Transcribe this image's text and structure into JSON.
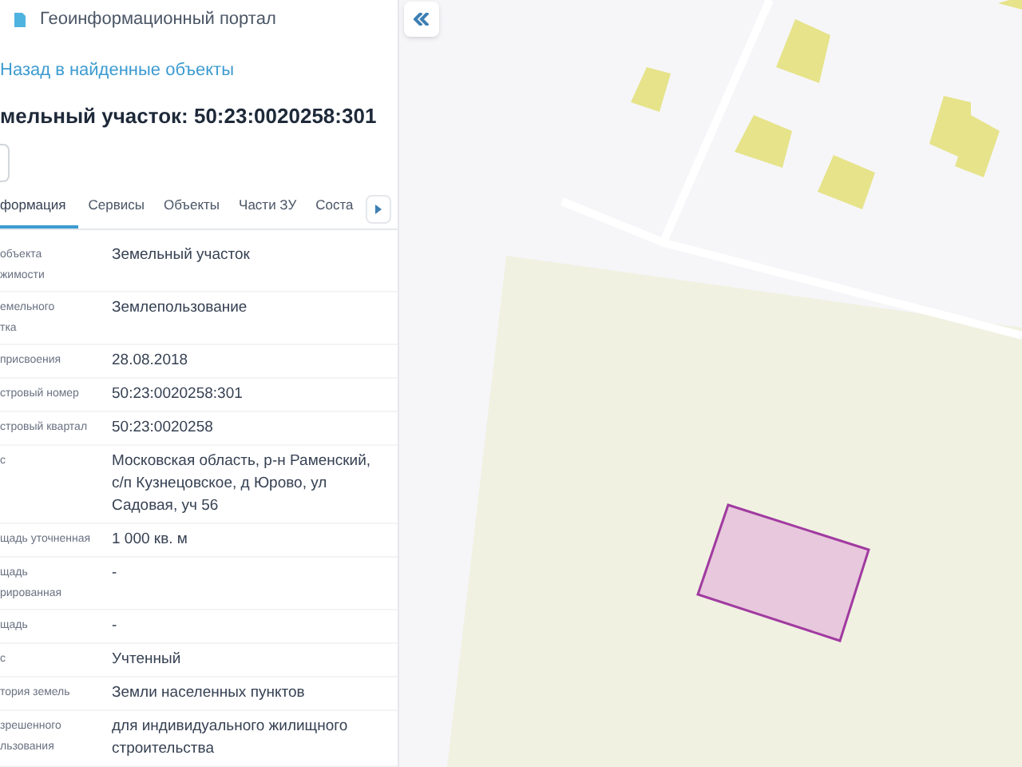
{
  "header": {
    "title": "Геоинформационный портал"
  },
  "back_link": "Назад в найденные объекты",
  "object_title": "мельный участок: 50:23:0020258:301",
  "tabs": [
    {
      "label": "формация",
      "selected": true
    },
    {
      "label": "Сервисы",
      "selected": false
    },
    {
      "label": "Объекты",
      "selected": false
    },
    {
      "label": "Части ЗУ",
      "selected": false
    },
    {
      "label": "Соста",
      "selected": false
    }
  ],
  "properties": [
    {
      "label": [
        "объекта",
        "жимости"
      ],
      "value": [
        "Земельный участок"
      ]
    },
    {
      "label": [
        "емельного",
        "тка"
      ],
      "value": [
        "Землепользование"
      ]
    },
    {
      "label": [
        "присвоения"
      ],
      "value": [
        "28.08.2018"
      ]
    },
    {
      "label": [
        "стровый номер"
      ],
      "value": [
        "50:23:0020258:301"
      ]
    },
    {
      "label": [
        "стровый квартал"
      ],
      "value": [
        "50:23:0020258"
      ]
    },
    {
      "label": [
        "с"
      ],
      "value": [
        "Московская область, р-н Раменский,",
        "с/п Кузнецовское, д Юрово, ул",
        "Садовая, уч 56"
      ]
    },
    {
      "label": [
        "щадь уточненная"
      ],
      "value": [
        "1 000 кв. м"
      ]
    },
    {
      "label": [
        "щадь",
        "рированная"
      ],
      "value": [
        "-"
      ]
    },
    {
      "label": [
        "щадь"
      ],
      "value": [
        "-"
      ]
    },
    {
      "label": [
        "с"
      ],
      "value": [
        "Учтенный"
      ]
    },
    {
      "label": [
        "тория земель"
      ],
      "value": [
        "Земли населенных пунктов"
      ]
    },
    {
      "label": [
        "зрешенного",
        "льзования"
      ],
      "value": [
        "для индивидуального жилищного",
        "строительства"
      ]
    }
  ]
}
